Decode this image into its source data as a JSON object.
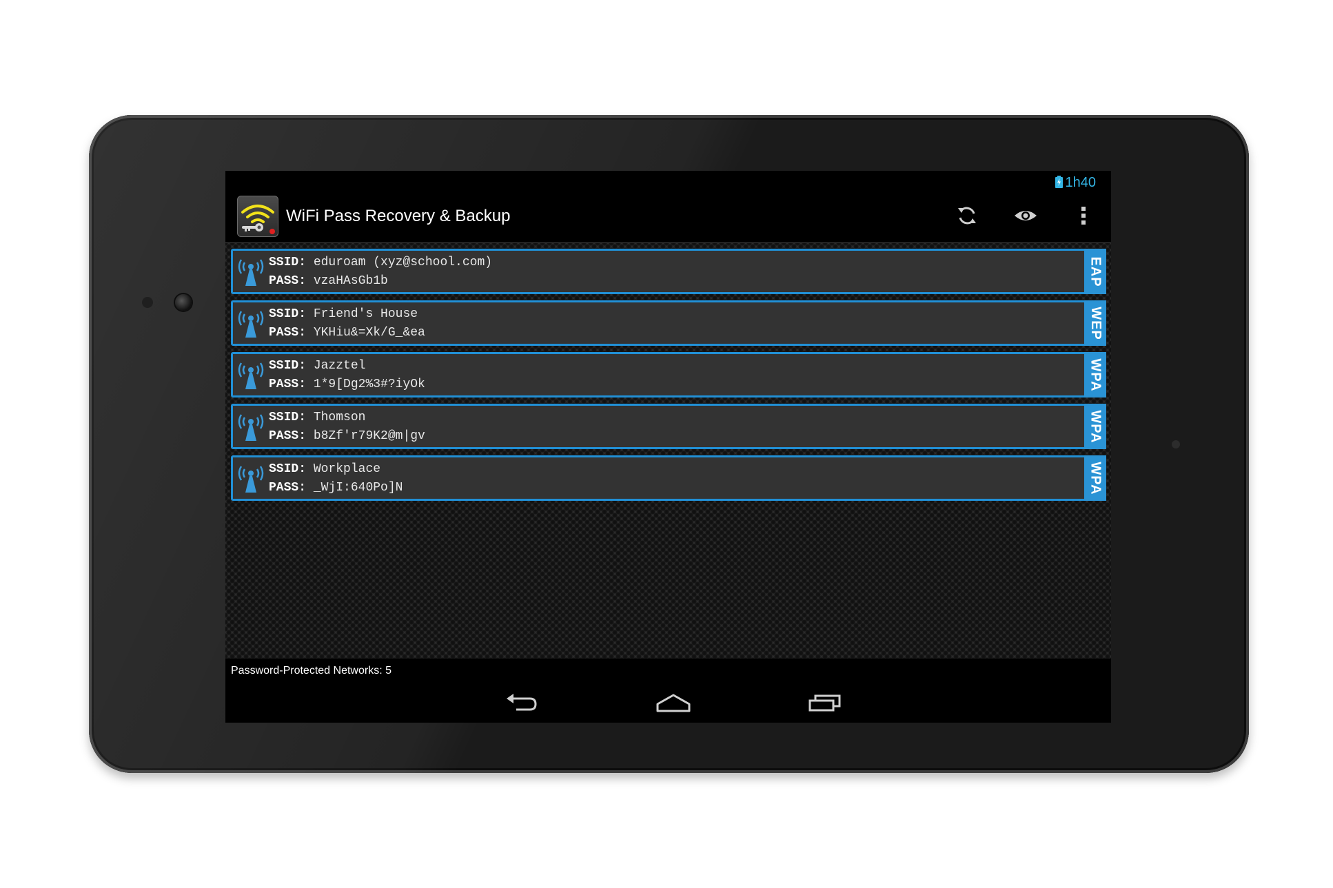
{
  "status_bar": {
    "time": "1h40"
  },
  "action_bar": {
    "title": "WiFi Pass Recovery & Backup",
    "icons": [
      "refresh-icon",
      "eye-icon",
      "overflow-menu-icon"
    ]
  },
  "labels": {
    "ssid": "SSID:",
    "pass": "PASS:"
  },
  "networks": [
    {
      "ssid": "eduroam (xyz@school.com)",
      "pass": "vzaHAsGb1b",
      "type": "EAP"
    },
    {
      "ssid": "Friend's House",
      "pass": "YKHiu&=Xk/G_&ea",
      "type": "WEP"
    },
    {
      "ssid": "Jazztel",
      "pass": "1*9[Dg2%3#?iyOk",
      "type": "WPA"
    },
    {
      "ssid": "Thomson",
      "pass": "b8Zf'r79K2@m|gv",
      "type": "WPA"
    },
    {
      "ssid": "Workplace",
      "pass": "_WjI:640Po]N",
      "type": "WPA"
    }
  ],
  "footer": {
    "summary": "Password-Protected Networks: 5"
  },
  "colors": {
    "accent": "#33b5e5",
    "row_border": "#2190d6",
    "badge": "#2a93d5"
  }
}
